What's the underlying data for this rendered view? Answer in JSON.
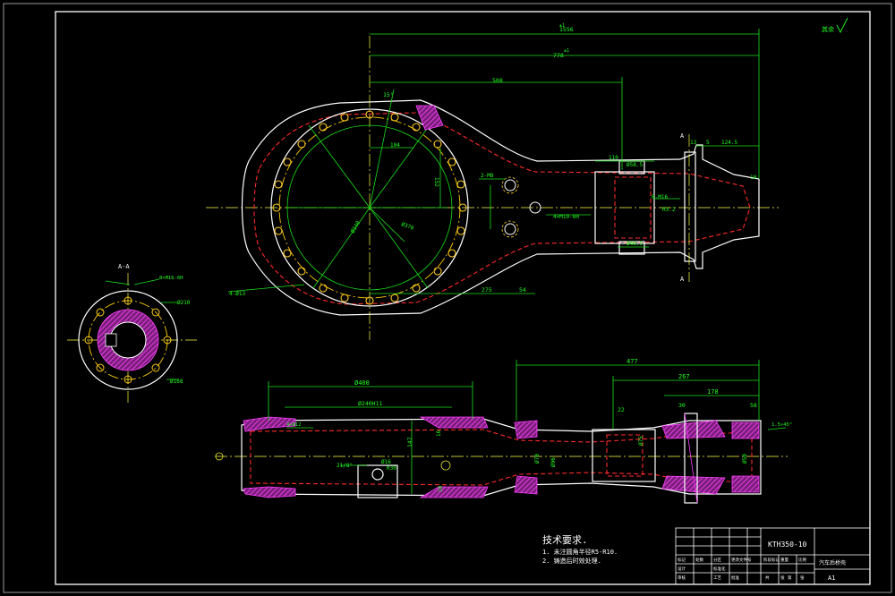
{
  "drawing_number": "KTH350-10",
  "scale": "A1",
  "roughness_mark": "其余",
  "tech_req": {
    "title": "技术要求.",
    "item1": "1. 未注圆角半径R5-R10.",
    "item2": "2. 铸造后时效处理."
  },
  "title_block": {
    "part_name": "汽车后桥壳",
    "cells": [
      "标记",
      "处数",
      "分区",
      "更改文件号",
      "签名",
      "年月日",
      "设计",
      "标准化",
      "阶段标记",
      "重量",
      "比例",
      "审核",
      "工艺",
      "批准",
      "共",
      "张",
      "第",
      "张"
    ]
  },
  "section_label": "A-A",
  "dims_top": {
    "d1": "1556",
    "d1_tol": "±1",
    "d2": "778",
    "d2_tol": "±1",
    "d3": "508",
    "d4": "15°",
    "d5": "104",
    "d6": "152",
    "d7": "275",
    "d8": "54",
    "d9": "110",
    "d10": "Ø58.5",
    "d11": "124.5",
    "d12": "5",
    "d13": "13",
    "d14": "10",
    "d15": "Ø46.5",
    "d16": "8-M16",
    "d17": "R3.2",
    "d18": "Ø340",
    "d19": "Ø370",
    "d20": "2-M8",
    "d21": "4×M10-6H",
    "d22": "4-Ø13"
  },
  "dims_bottom": {
    "d1": "477",
    "d2": "267",
    "d3": "178",
    "d4": "Ø400",
    "d5": "Ø240H11",
    "d6": "147",
    "d7": "Ø16",
    "d8": "R30",
    "d9": "21/8\"",
    "d10": "22",
    "d11": "30",
    "d12": "58",
    "d13": "16",
    "d14": "10",
    "d15": "4×Ø12",
    "d16": "Ø70",
    "d17": "Ø96",
    "d18": "Ø75",
    "d19": "Ø50",
    "d20": "1.5×45°"
  },
  "dims_flange": {
    "d1": "Ø210",
    "d2": "Ø168",
    "d3": "8×M16-6H"
  }
}
